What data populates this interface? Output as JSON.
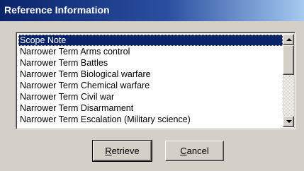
{
  "window": {
    "title": "Reference Information"
  },
  "list": {
    "items": [
      {
        "label": "Scope Note",
        "selected": true
      },
      {
        "label": "Narrower Term Arms control",
        "selected": false
      },
      {
        "label": "Narrower Term Battles",
        "selected": false
      },
      {
        "label": "Narrower Term Biological warfare",
        "selected": false
      },
      {
        "label": "Narrower Term Chemical warfare",
        "selected": false
      },
      {
        "label": "Narrower Term Civil war",
        "selected": false
      },
      {
        "label": "Narrower Term Disarmament",
        "selected": false
      },
      {
        "label": "Narrower Term Escalation (Military science)",
        "selected": false
      }
    ]
  },
  "buttons": {
    "retrieve": {
      "mnemonic": "R",
      "rest": "etrieve"
    },
    "cancel": {
      "mnemonic": "C",
      "rest": "ancel"
    }
  },
  "colors": {
    "title_bar_start": "#0a246a",
    "title_bar_end": "#a6caf0",
    "selection": "#0a246a",
    "face": "#d4d0c8"
  }
}
